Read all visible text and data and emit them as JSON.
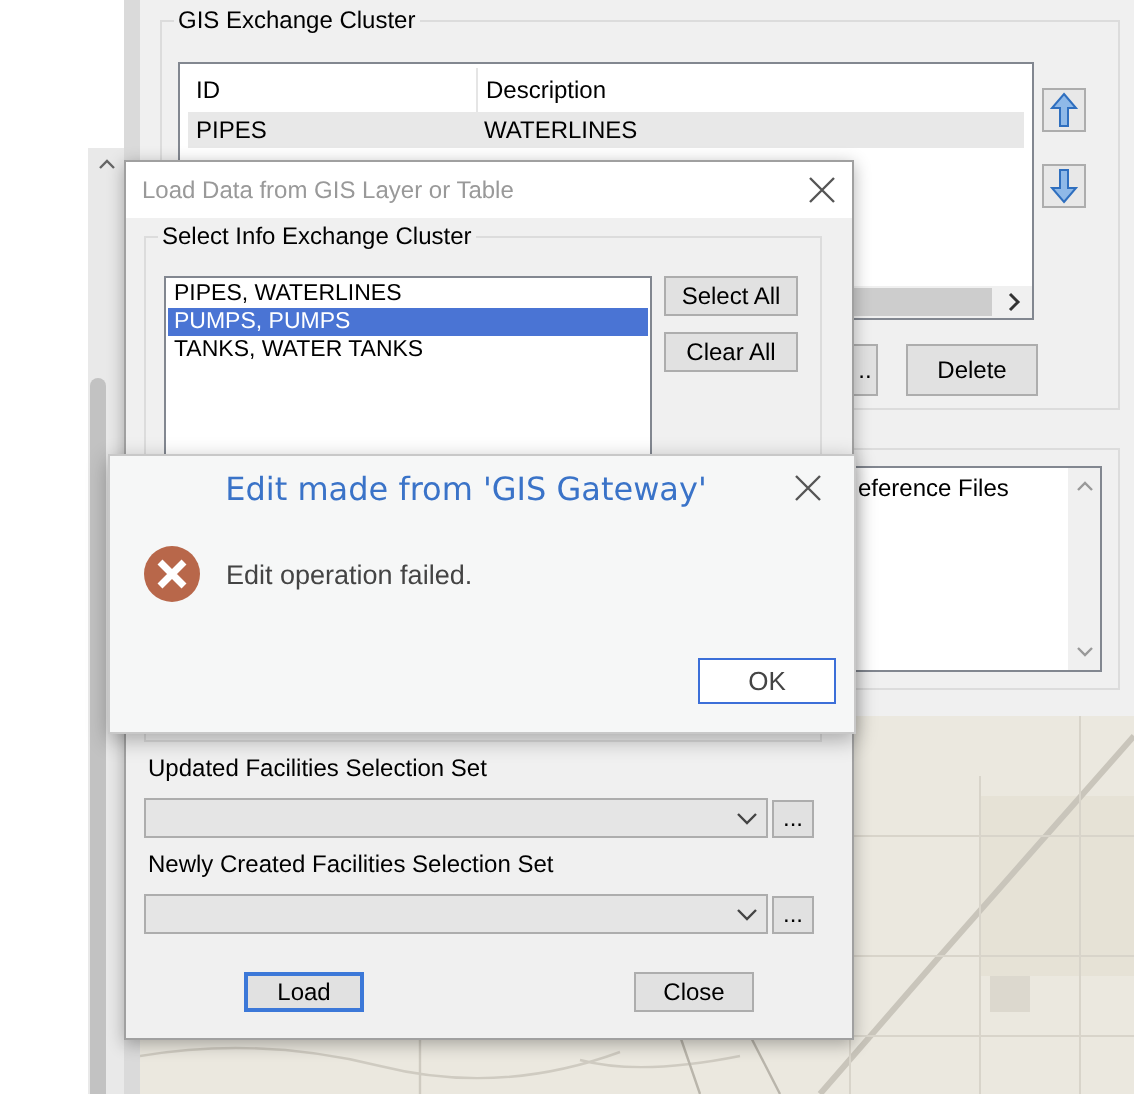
{
  "main_panel": {
    "cluster_group": {
      "title": "GIS Exchange Cluster",
      "columns": [
        "ID",
        "Description"
      ],
      "rows": [
        {
          "cells": [
            "PIPES",
            "WATERLINES"
          ],
          "selected": true
        }
      ],
      "buttons": [
        "..",
        "Delete"
      ]
    },
    "reference_list": {
      "items": [
        "eference Files"
      ]
    }
  },
  "load_dialog": {
    "title": "Load Data from GIS Layer or Table",
    "group_title": "Select Info Exchange Cluster",
    "items": [
      {
        "label": "PIPES, WATERLINES",
        "selected": false
      },
      {
        "label": "PUMPS, PUMPS",
        "selected": true
      },
      {
        "label": "TANKS, WATER TANKS",
        "selected": false
      }
    ],
    "list_buttons": [
      "Select All",
      "Clear All"
    ],
    "fields": [
      {
        "label": "Updated Facilities Selection Set",
        "browse": "..."
      },
      {
        "label": "Newly Created Facilities Selection Set",
        "browse": "..."
      }
    ],
    "actions": [
      {
        "label": "Load",
        "default": true
      },
      {
        "label": "Close",
        "default": false
      }
    ]
  },
  "error_dialog": {
    "title": "Edit made from 'GIS Gateway'",
    "message": "Edit operation failed.",
    "button": "OK"
  }
}
